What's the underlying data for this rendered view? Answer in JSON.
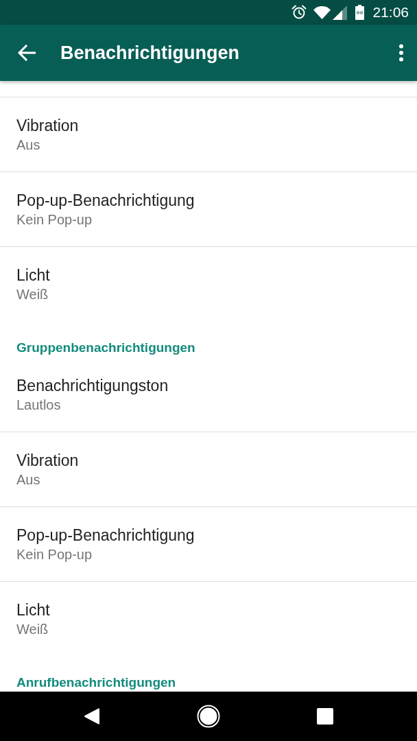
{
  "status_bar": {
    "time": "21:06"
  },
  "toolbar": {
    "title": "Benachrichtigungen"
  },
  "list": [
    {
      "kind": "setting",
      "title": "Vibration",
      "value": "Aus"
    },
    {
      "kind": "setting",
      "title": "Pop-up-Benachrichtigung",
      "value": "Kein Pop-up"
    },
    {
      "kind": "setting",
      "title": "Licht",
      "value": "Weiß"
    },
    {
      "kind": "header",
      "title": "Gruppenbenachrichtigungen"
    },
    {
      "kind": "setting",
      "title": "Benachrichtigungston",
      "value": "Lautlos"
    },
    {
      "kind": "setting",
      "title": "Vibration",
      "value": "Aus"
    },
    {
      "kind": "setting",
      "title": "Pop-up-Benachrichtigung",
      "value": "Kein Pop-up"
    },
    {
      "kind": "setting",
      "title": "Licht",
      "value": "Weiß"
    },
    {
      "kind": "header",
      "title": "Anrufbenachrichtigungen"
    }
  ]
}
